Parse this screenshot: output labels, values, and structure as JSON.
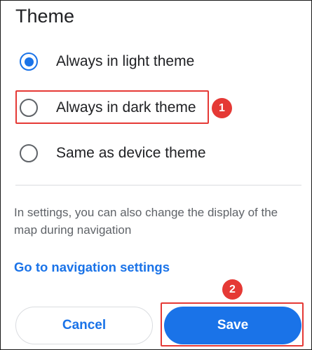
{
  "dialog": {
    "title": "Theme",
    "options": [
      {
        "label": "Always in light theme",
        "selected": true
      },
      {
        "label": "Always in dark theme",
        "selected": false
      },
      {
        "label": "Same as device theme",
        "selected": false
      }
    ],
    "info_text": "In settings, you can also change the display of the map during navigation",
    "nav_link_label": "Go to navigation settings",
    "cancel_label": "Cancel",
    "save_label": "Save"
  },
  "annotations": {
    "step_1": "1",
    "step_2": "2"
  },
  "colors": {
    "accent": "#1a73e8",
    "annotation": "#e53935",
    "text_primary": "#202124",
    "text_secondary": "#5f6368"
  }
}
